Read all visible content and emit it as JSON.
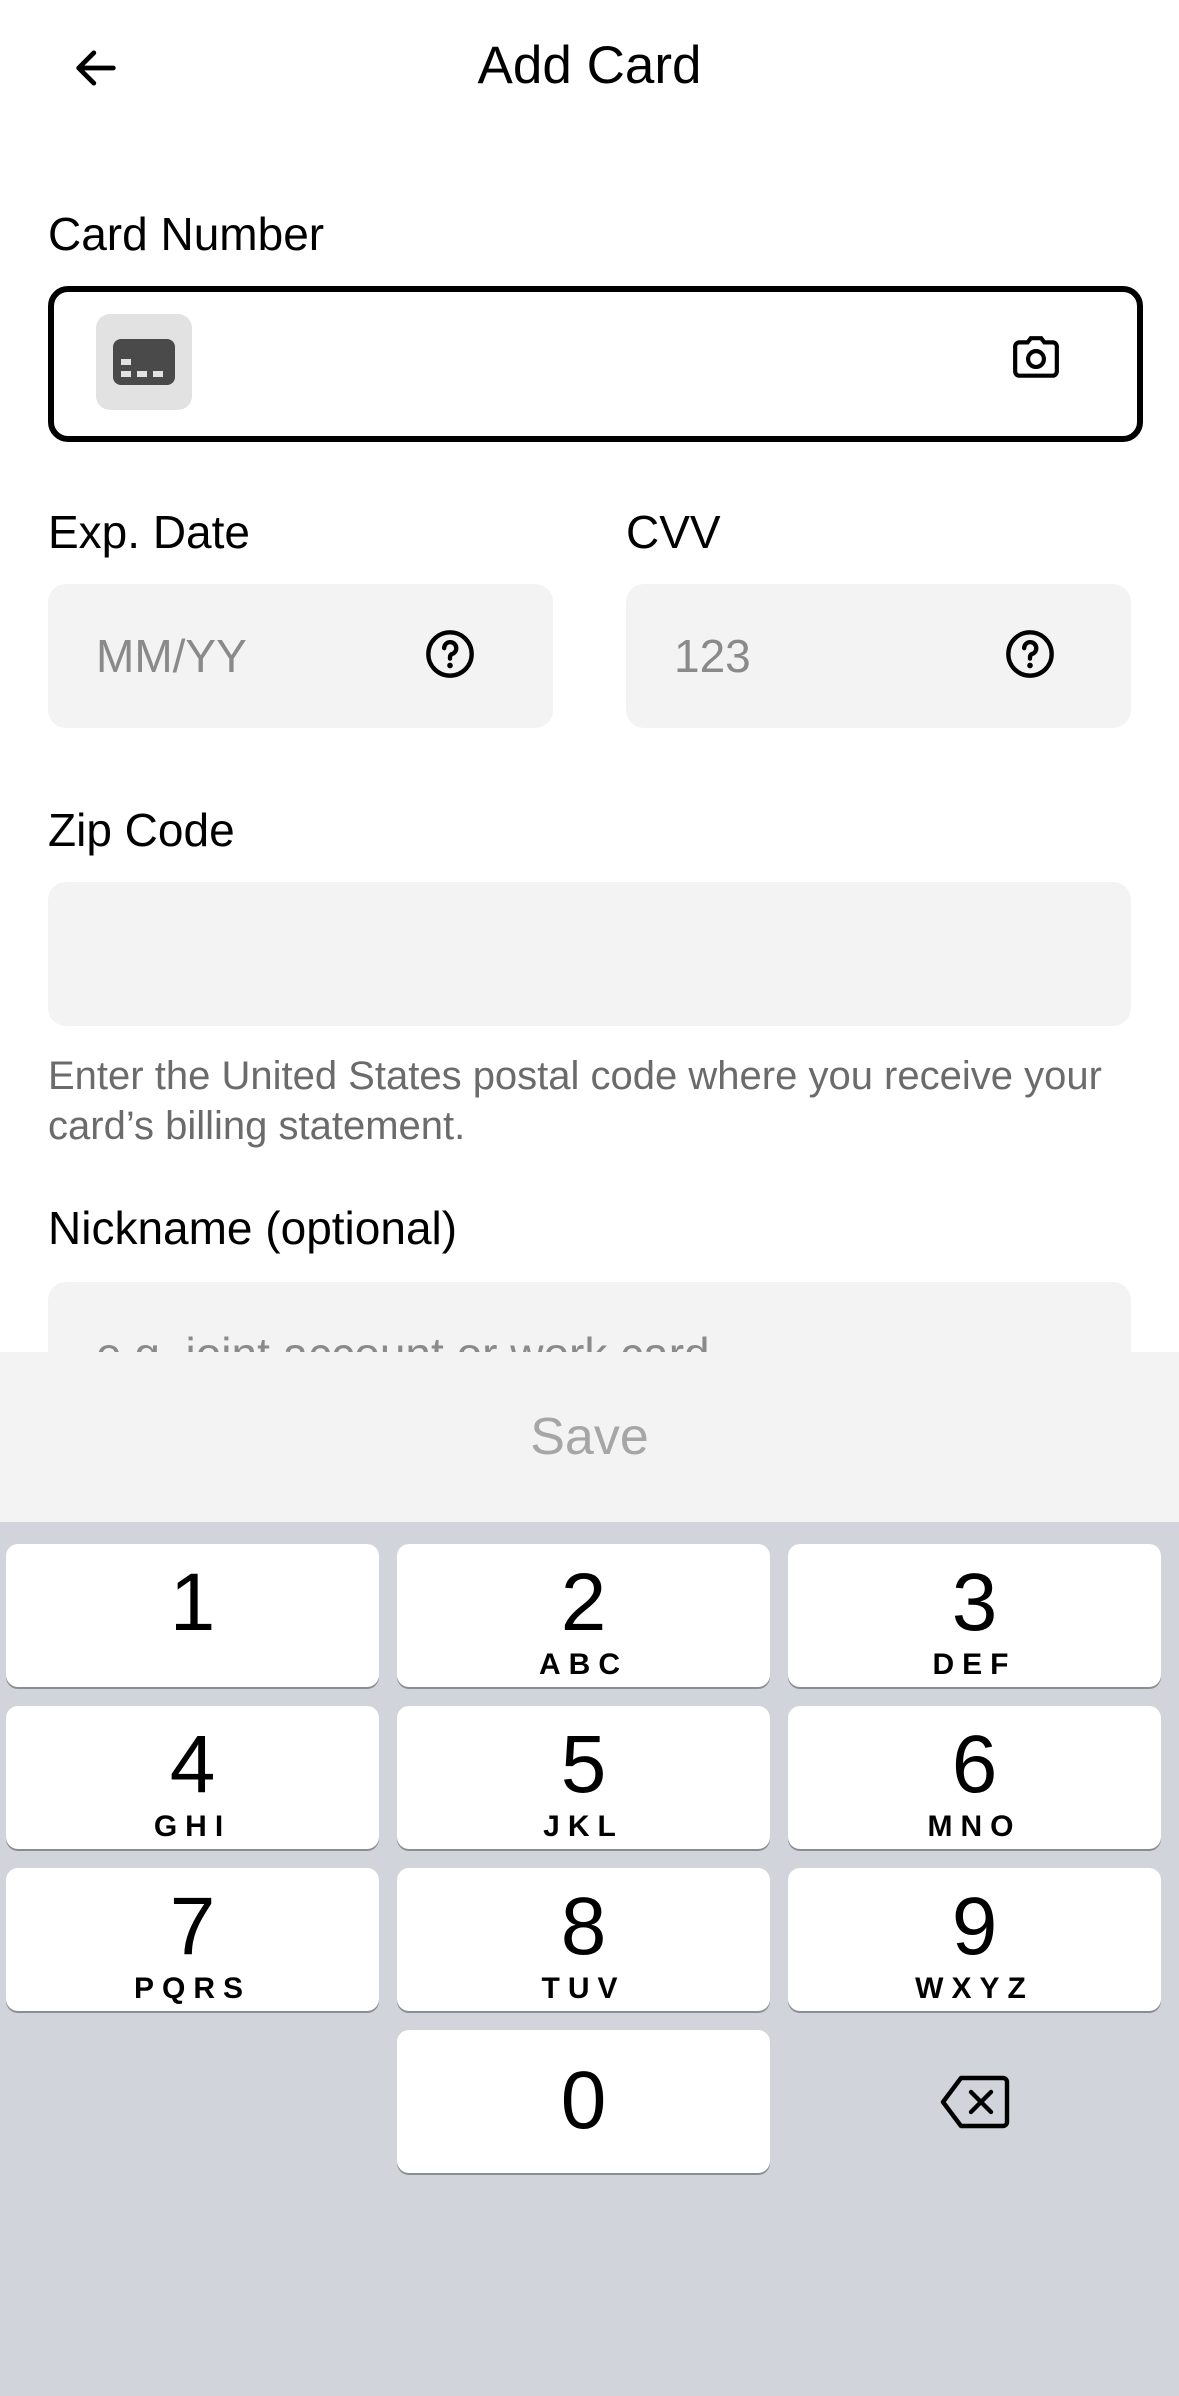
{
  "header": {
    "title": "Add Card",
    "back_icon": "arrow-left-icon"
  },
  "card_number": {
    "label": "Card Number",
    "value": "",
    "card_icon": "credit-card-icon",
    "camera_icon": "camera-icon"
  },
  "exp_date": {
    "label": "Exp. Date",
    "placeholder": "MM/YY",
    "help_icon": "question-circle-icon"
  },
  "cvv": {
    "label": "CVV",
    "placeholder": "123",
    "help_icon": "question-circle-icon"
  },
  "zip_code": {
    "label": "Zip Code",
    "value": "",
    "help_text": "Enter the United States postal code where you receive your card’s billing statement."
  },
  "nickname": {
    "label": "Nickname (optional)",
    "placeholder": "e.g. joint account or work card"
  },
  "save": {
    "label": "Save",
    "enabled": false
  },
  "keyboard": {
    "keys": [
      {
        "digit": "1",
        "letters": ""
      },
      {
        "digit": "2",
        "letters": "ABC"
      },
      {
        "digit": "3",
        "letters": "DEF"
      },
      {
        "digit": "4",
        "letters": "GHI"
      },
      {
        "digit": "5",
        "letters": "JKL"
      },
      {
        "digit": "6",
        "letters": "MNO"
      },
      {
        "digit": "7",
        "letters": "PQRS"
      },
      {
        "digit": "8",
        "letters": "TUV"
      },
      {
        "digit": "9",
        "letters": "WXYZ"
      },
      {
        "digit": "0",
        "letters": ""
      }
    ],
    "backspace_icon": "backspace-icon"
  },
  "colors": {
    "field_bg": "#f3f3f3",
    "keyboard_bg": "#d1d4da",
    "save_disabled_text": "#a6a6a6"
  }
}
